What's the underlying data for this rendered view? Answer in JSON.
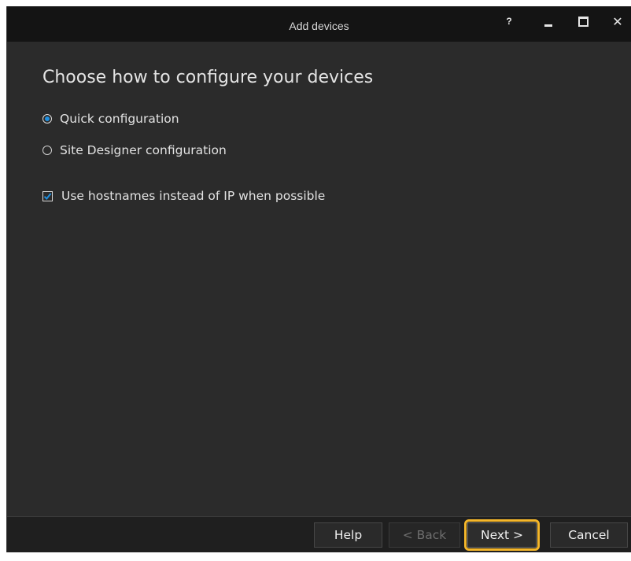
{
  "window": {
    "title": "Add devices",
    "controls": {
      "help": "?",
      "minimize_icon": "minimize-icon",
      "maximize_icon": "maximize-icon",
      "close": "✕"
    }
  },
  "main": {
    "heading": "Choose how to configure your devices",
    "options": [
      {
        "label": "Quick configuration",
        "selected": true
      },
      {
        "label": "Site Designer configuration",
        "selected": false
      }
    ],
    "hostname_checkbox": {
      "label": "Use hostnames instead of IP when possible",
      "checked": true
    }
  },
  "footer": {
    "help_label": "Help",
    "back_label": "< Back",
    "next_label": "Next >",
    "cancel_label": "Cancel"
  },
  "colors": {
    "accent": "#1f8fe0",
    "highlight": "#f4b62a",
    "background": "#2b2b2b",
    "titlebar": "#141414"
  }
}
